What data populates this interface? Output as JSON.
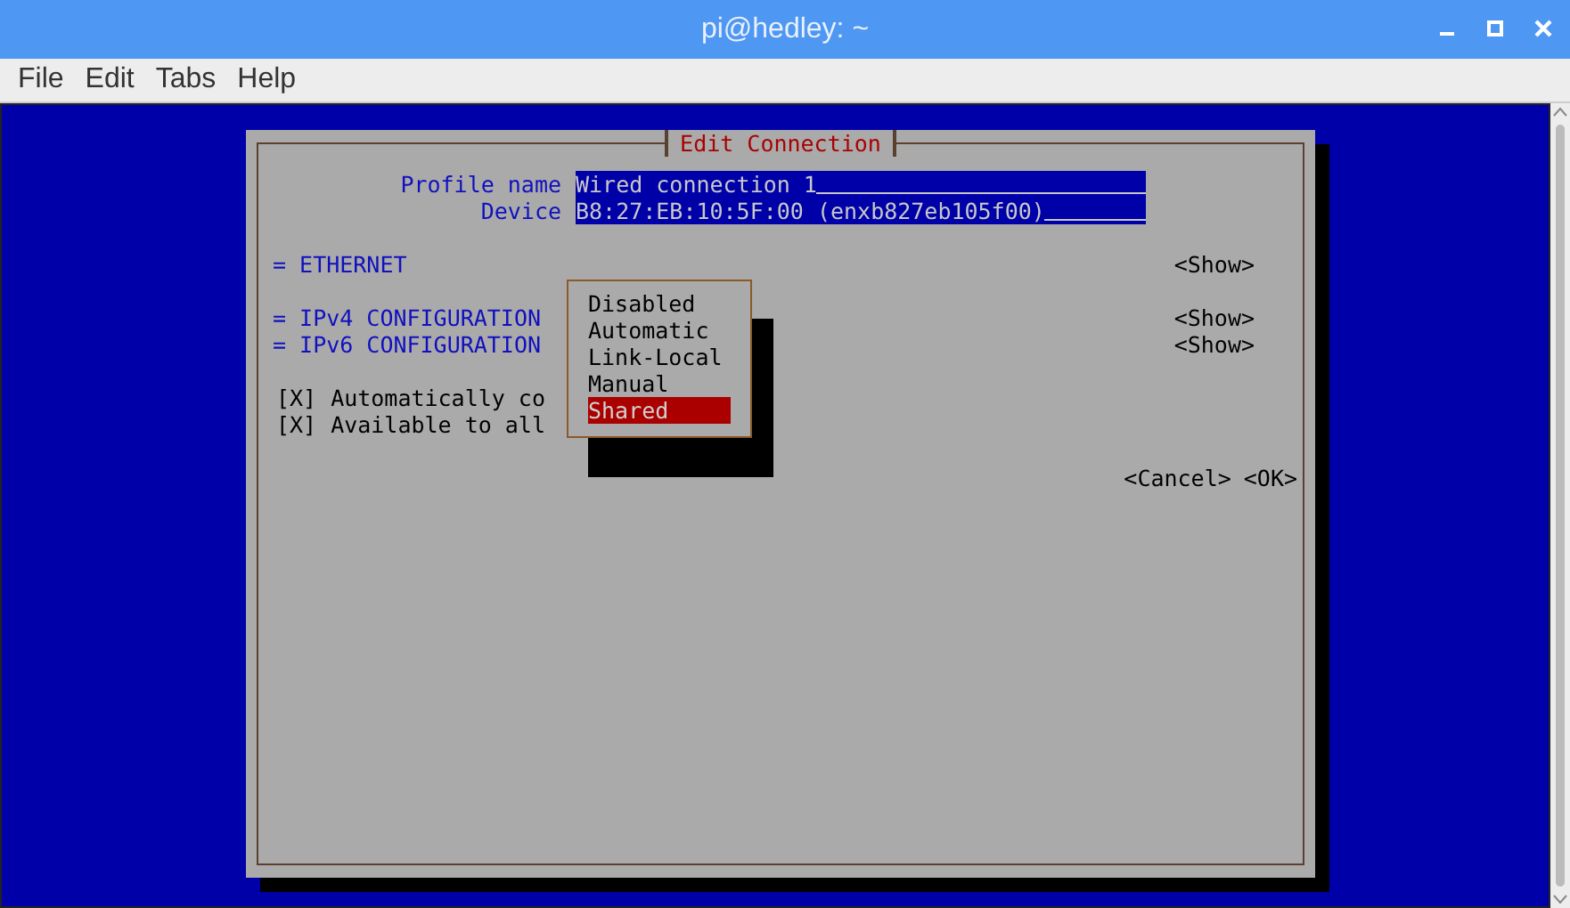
{
  "window": {
    "title": "pi@hedley: ~"
  },
  "menu": [
    "File",
    "Edit",
    "Tabs",
    "Help"
  ],
  "dialog": {
    "title": "Edit Connection",
    "fields": [
      {
        "label": "Profile name",
        "value": "Wired connection 1"
      },
      {
        "label": "Device",
        "value": "B8:27:EB:10:5F:00 (enxb827eb105f00)"
      }
    ],
    "section_groups": [
      [
        {
          "label": "= ETHERNET",
          "action": "<Show>"
        }
      ],
      [
        {
          "label": "= IPv4 CONFIGURATION",
          "action": "<Show>"
        },
        {
          "label": "= IPv6 CONFIGURATION",
          "action": "<Show>"
        }
      ]
    ],
    "checkboxes": [
      {
        "box": "[X]",
        "label": "Automatically co",
        "checked": true
      },
      {
        "box": "[X]",
        "label": "Available to all",
        "checked": true
      }
    ],
    "buttons": [
      "<Cancel>",
      "<OK>"
    ],
    "popup": {
      "options": [
        {
          "label": "Disabled",
          "selected": false
        },
        {
          "label": "Automatic",
          "selected": false
        },
        {
          "label": "Link-Local",
          "selected": false
        },
        {
          "label": "Manual",
          "selected": false
        },
        {
          "label": "Shared",
          "selected": true
        }
      ]
    }
  }
}
